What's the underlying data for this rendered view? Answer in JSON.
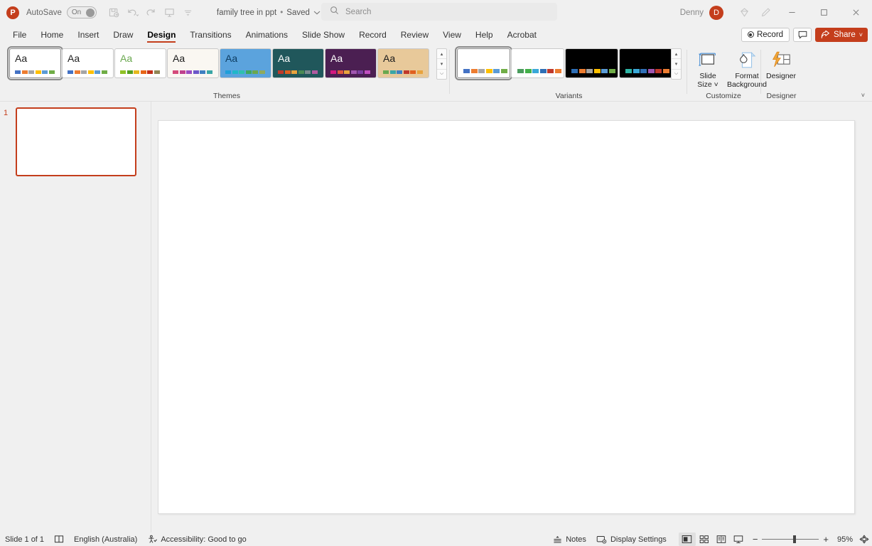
{
  "app": {
    "name": "PowerPoint",
    "logo_letter": "P"
  },
  "titlebar": {
    "autosave_label": "AutoSave",
    "autosave_state": "On",
    "document_title": "family tree in ppt",
    "save_state": "Saved",
    "separator": "•",
    "quick_access": [
      {
        "name": "save-icon",
        "label": "Save"
      },
      {
        "name": "undo-icon",
        "label": "Undo"
      },
      {
        "name": "redo-icon",
        "label": "Redo"
      },
      {
        "name": "start-presentation-icon",
        "label": "Start from Beginning"
      },
      {
        "name": "customize-quick-access-toolbar-icon",
        "label": "Customize Quick Access Toolbar"
      }
    ],
    "user_name": "Denny",
    "user_initial": "D",
    "ribbon_display_icon": "ribbon-display-options-icon",
    "pen_icon": "pen-icon",
    "window_controls": {
      "minimize": "–",
      "maximize": "□",
      "close": "×"
    }
  },
  "search": {
    "placeholder": "Search",
    "value": "",
    "icon": "search-icon"
  },
  "tabs": [
    {
      "label": "File",
      "active": false
    },
    {
      "label": "Home",
      "active": false
    },
    {
      "label": "Insert",
      "active": false
    },
    {
      "label": "Draw",
      "active": false
    },
    {
      "label": "Design",
      "active": true
    },
    {
      "label": "Transitions",
      "active": false
    },
    {
      "label": "Animations",
      "active": false
    },
    {
      "label": "Slide Show",
      "active": false
    },
    {
      "label": "Record",
      "active": false
    },
    {
      "label": "Review",
      "active": false
    },
    {
      "label": "View",
      "active": false
    },
    {
      "label": "Help",
      "active": false
    },
    {
      "label": "Acrobat",
      "active": false
    }
  ],
  "tab_actions": {
    "record_label": "Record",
    "comments_label": "Comments",
    "share_label": "Share",
    "share_caret": "˅",
    "accent_color": "#c43e1c"
  },
  "ribbon": {
    "collapse_label": "˅",
    "groups": [
      {
        "name": "themes",
        "label": "Themes"
      },
      {
        "name": "variants",
        "label": "Variants"
      },
      {
        "name": "customize",
        "label": "Customize"
      },
      {
        "name": "designer",
        "label": "Designer"
      }
    ],
    "themes": {
      "label": "Themes",
      "items": [
        {
          "name": "office-theme",
          "aa": "Aa",
          "selected": true,
          "bg": "#ffffff",
          "fg": "#222222",
          "swatches": [
            "#4472c4",
            "#ed7d31",
            "#a5a5a5",
            "#ffc000",
            "#5b9bd5",
            "#70ad47"
          ]
        },
        {
          "name": "office-theme-2",
          "aa": "Aa",
          "selected": false,
          "bg": "#ffffff",
          "fg": "#222222",
          "swatches": [
            "#4472c4",
            "#ed7d31",
            "#a5a5a5",
            "#ffc000",
            "#5b9bd5",
            "#70ad47"
          ]
        },
        {
          "name": "facet-theme",
          "aa": "Aa",
          "selected": false,
          "bg": "#ffffff",
          "fg": "#6aa84f",
          "swatches": [
            "#90c226",
            "#54a021",
            "#e6b91e",
            "#e76618",
            "#c42f1a",
            "#918655"
          ]
        },
        {
          "name": "wisp-theme",
          "aa": "Aa",
          "selected": false,
          "bg": "#faf7f2",
          "fg": "#1a1a1a",
          "swatches": [
            "#d44a7a",
            "#c0418e",
            "#9b4ec2",
            "#6c57c9",
            "#3f7fc1",
            "#3aa6a6"
          ]
        },
        {
          "name": "dividend-theme",
          "aa": "Aa",
          "selected": false,
          "bg": "#5ba3dd",
          "fg": "#0d3c61",
          "swatches": [
            "#1f9fd9",
            "#20b7c9",
            "#2ec0b0",
            "#3fa85f",
            "#6aa84f",
            "#8faa5e"
          ]
        },
        {
          "name": "slice-theme",
          "aa": "Aa",
          "selected": false,
          "bg": "#20575b",
          "fg": "#ffffff",
          "swatches": [
            "#c0392b",
            "#e06020",
            "#e8a33d",
            "#4a8a54",
            "#7a8a8f",
            "#b05aa0"
          ]
        },
        {
          "name": "berlin-theme",
          "aa": "Aa",
          "selected": false,
          "bg": "#4b1f52",
          "fg": "#ffffff",
          "swatches": [
            "#d3177f",
            "#e0573c",
            "#e8a33d",
            "#a055b0",
            "#7b3fa0",
            "#c04fc0"
          ]
        },
        {
          "name": "wood-type-theme",
          "aa": "Aa",
          "selected": false,
          "bg": "#e8c99a",
          "fg": "#1a1a1a",
          "swatches": [
            "#6aa84f",
            "#3aa6a6",
            "#3f7fc1",
            "#c0392b",
            "#e06020",
            "#e8a33d"
          ]
        }
      ],
      "scroll_up": "▴",
      "scroll_down": "▾",
      "more": "⌵"
    },
    "variants": {
      "label": "Variants",
      "items": [
        {
          "name": "variant-1",
          "selected": true,
          "bg": "#ffffff",
          "swatches": [
            "#4472c4",
            "#ed7d31",
            "#a5a5a5",
            "#ffc000",
            "#5b9bd5",
            "#70ad47"
          ]
        },
        {
          "name": "variant-2",
          "selected": false,
          "bg": "#ffffff",
          "swatches": [
            "#4a9c5d",
            "#43b049",
            "#3aa8d8",
            "#2f6fb5",
            "#c0392b",
            "#ed7d31"
          ]
        },
        {
          "name": "variant-3",
          "selected": false,
          "bg": "#000000",
          "swatches": [
            "#2f6fb5",
            "#ed7d31",
            "#a5a5a5",
            "#ffc000",
            "#5b9bd5",
            "#70ad47"
          ]
        },
        {
          "name": "variant-4",
          "selected": false,
          "bg": "#000000",
          "swatches": [
            "#2eb5a5",
            "#3aa8d8",
            "#2f6fb5",
            "#a055b0",
            "#c0392b",
            "#ed7d31"
          ]
        }
      ],
      "scroll_up": "▴",
      "scroll_down": "▾",
      "more": "⌵"
    },
    "customize": {
      "label": "Customize",
      "buttons": [
        {
          "name": "slide-size-button",
          "icon": "slide-size-icon",
          "line1": "Slide",
          "line2": "Size ˅"
        },
        {
          "name": "format-background-button",
          "icon": "format-background-icon",
          "line1": "Format",
          "line2": "Background"
        }
      ]
    },
    "designer": {
      "label": "Designer",
      "buttons": [
        {
          "name": "designer-button",
          "icon": "designer-icon",
          "line1": "Designer",
          "line2": ""
        }
      ]
    }
  },
  "thumbnail_pane": {
    "slides": [
      {
        "number": "1",
        "name": "slide-thumbnail-1",
        "selected": true
      }
    ]
  },
  "slide_canvas": {
    "name": "slide-editing-canvas",
    "content": ""
  },
  "statusbar": {
    "slide_count_label": "Slide 1 of 1",
    "notes_indicator_icon": "slide-notes-icon",
    "language": "English (Australia)",
    "accessibility_icon": "accessibility-icon",
    "accessibility_label": "Accessibility: Good to go",
    "notes_label": "Notes",
    "notes_icon": "notes-icon",
    "display_settings_label": "Display Settings",
    "display_settings_icon": "display-settings-icon",
    "views": [
      {
        "name": "normal-view-button",
        "icon": "normal-view-icon",
        "active": true
      },
      {
        "name": "slide-sorter-view-button",
        "icon": "slide-sorter-icon",
        "active": false
      },
      {
        "name": "reading-view-button",
        "icon": "reading-view-icon",
        "active": false
      },
      {
        "name": "slide-show-button",
        "icon": "slide-show-icon",
        "active": false
      }
    ],
    "zoom_out": "−",
    "zoom_in": "+",
    "zoom_percent": "95%",
    "fit_icon": "fit-slide-to-window-icon"
  }
}
